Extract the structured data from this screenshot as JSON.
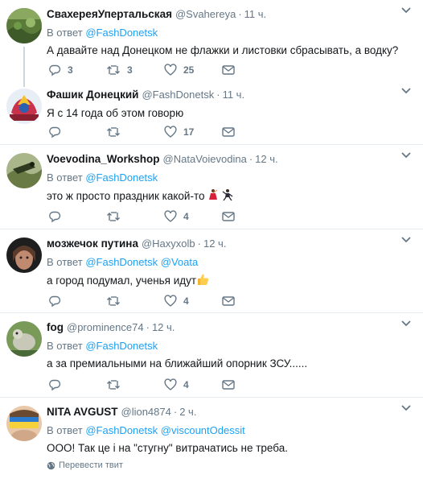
{
  "tweets": [
    {
      "name": "СвахереяУпертальская",
      "handle": "@Svahereya",
      "time": "11 ч.",
      "reply_label": "В ответ",
      "reply_to": [
        "@FashDonetsk"
      ],
      "text": "А давайте над Донецком не флажки и листовки сбрасывать, а водку?",
      "replies": "3",
      "retweets": "3",
      "likes": "25",
      "avatar_colors": [
        "#5a7a3a",
        "#8aa860",
        "#3d5a28"
      ]
    },
    {
      "name": "Фашик Донецкий",
      "handle": "@FashDonetsk",
      "time": "11 ч.",
      "text": "Я с 14 года об этом говорю",
      "replies": "",
      "retweets": "",
      "likes": "17",
      "avatar_colors": [
        "#c8324a",
        "#f2c230",
        "#2b5fb0"
      ]
    },
    {
      "name": "Voevodina_Workshop",
      "handle": "@NataVoievodina",
      "time": "12 ч.",
      "reply_label": "В ответ",
      "reply_to": [
        "@FashDonetsk"
      ],
      "text": "это ж просто праздник какой-то",
      "replies": "",
      "retweets": "",
      "likes": "4",
      "avatar_colors": [
        "#6a7a44",
        "#a8b68a",
        "#2e3a20"
      ]
    },
    {
      "name": "мозжечок путина",
      "handle": "@Haxyxolb",
      "time": "12 ч.",
      "reply_label": "В ответ",
      "reply_to": [
        "@FashDonetsk",
        "@Voata"
      ],
      "text": "а город подумал, ученья идут",
      "replies": "",
      "retweets": "",
      "likes": "4",
      "avatar_colors": [
        "#1e1e1e",
        "#5a3a2a",
        "#c08a70"
      ]
    },
    {
      "name": "fog",
      "handle": "@prominence74",
      "time": "12 ч.",
      "reply_label": "В ответ",
      "reply_to": [
        "@FashDonetsk"
      ],
      "text": "а за премиальными на ближайший опорник ЗСУ......",
      "replies": "",
      "retweets": "",
      "likes": "4",
      "avatar_colors": [
        "#7a9a5a",
        "#c8c8b8",
        "#4a6a3a"
      ]
    },
    {
      "name": "NITA AVGUST",
      "handle": "@lion4874",
      "time": "2 ч.",
      "reply_label": "В ответ",
      "reply_to": [
        "@FashDonetsk",
        "@viscountOdessit"
      ],
      "text": "ООО! Так це і на \"стугну\" витрачатись не треба.",
      "translate": "Перевести твит",
      "avatar_colors": [
        "#2a7ad0",
        "#f6d23a",
        "#e8c8a8"
      ]
    }
  ],
  "colors": {
    "link": "#1da1f2",
    "muted": "#657786",
    "text": "#14171a",
    "divider": "#e6ecf0"
  },
  "icons": [
    "reply-icon",
    "retweet-icon",
    "like-icon",
    "dm-icon",
    "chevron-down-icon",
    "globe-icon"
  ]
}
